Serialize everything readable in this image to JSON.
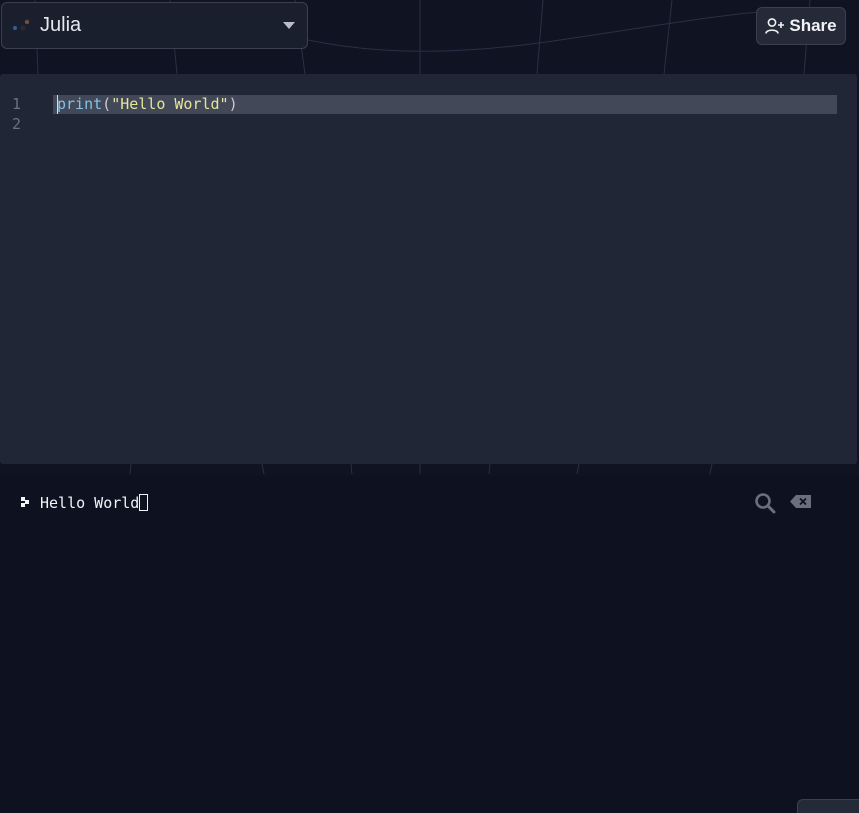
{
  "header": {
    "language": "Julia",
    "share_label": "Share"
  },
  "editor": {
    "line_numbers": [
      "1",
      "2"
    ],
    "lines": [
      [
        {
          "t": "fn",
          "text": "print"
        },
        {
          "t": "punc",
          "text": "("
        },
        {
          "t": "str",
          "text": "\"Hello World\""
        },
        {
          "t": "punc",
          "text": ")"
        }
      ],
      []
    ]
  },
  "console": {
    "output": "Hello World"
  },
  "colors": {
    "background": "#0f1322",
    "editor_bg": "#212636",
    "string": "#e4e49a",
    "function": "#7fc4e8"
  },
  "icons": {
    "language": "julia-logo-icon",
    "dropdown": "chevron-down-icon",
    "share": "add-user-icon",
    "prompt": "prompt-icon",
    "search": "search-icon",
    "clear": "backspace-icon"
  }
}
